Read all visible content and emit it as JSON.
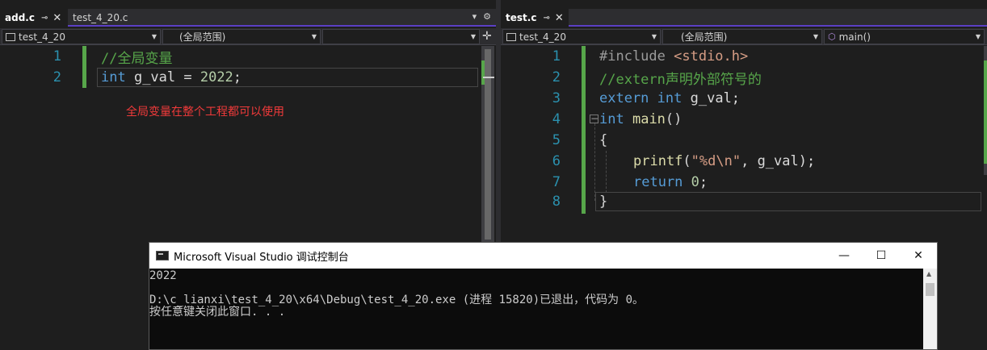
{
  "left_editor": {
    "tabs": [
      {
        "label": "add.c",
        "active": true
      },
      {
        "label": "test_4_20.c",
        "active": false
      }
    ],
    "nav": {
      "project": "test_4_20",
      "scope": "(全局范围)",
      "member": ""
    },
    "lines": [
      {
        "no": "1",
        "comment": "//全局变量"
      },
      {
        "no": "2",
        "kw": "int",
        "rest": " g_val = ",
        "num": "2022",
        "end": ";"
      }
    ],
    "annotation": "全局变量在整个工程都可以使用"
  },
  "right_editor": {
    "tabs": [
      {
        "label": "test.c",
        "active": true
      }
    ],
    "nav": {
      "project": "test_4_20",
      "scope": "(全局范围)",
      "member": "main()"
    },
    "lines": {
      "l1": {
        "no": "1",
        "pp": "#include ",
        "str": "<stdio.h>"
      },
      "l2": {
        "no": "2",
        "comment": "//extern声明外部符号的"
      },
      "l3": {
        "no": "3",
        "kw1": "extern",
        "kw2": "int",
        "rest": " g_val;"
      },
      "l4": {
        "no": "4",
        "kw": "int",
        "fn": "main",
        "rest": "()"
      },
      "l5": {
        "no": "5",
        "text": "{"
      },
      "l6": {
        "no": "6",
        "fn": "printf",
        "open": "(",
        "str": "\"%d\\n\"",
        "rest": ", g_val);"
      },
      "l7": {
        "no": "7",
        "kw": "return",
        "num": "0",
        "rest": ";"
      },
      "l8": {
        "no": "8",
        "text": "}"
      }
    }
  },
  "console": {
    "title": "Microsoft Visual Studio 调试控制台",
    "output": [
      "2022",
      "",
      "D:\\c_lianxi\\test_4_20\\x64\\Debug\\test_4_20.exe (进程 15820)已退出，代码为 0。",
      "按任意键关闭此窗口. . ."
    ]
  },
  "icons": {
    "pin": "pin-icon",
    "close": "close-icon",
    "dropdown": "chevron-down-icon",
    "settings": "gear-icon",
    "split": "split-icon",
    "minimize": "minimize-icon",
    "maximize": "maximize-icon"
  },
  "colors": {
    "accent": "#5b3fc5",
    "keyword": "#569cd6",
    "comment": "#57a64a",
    "annotation": "#f03a3a"
  }
}
